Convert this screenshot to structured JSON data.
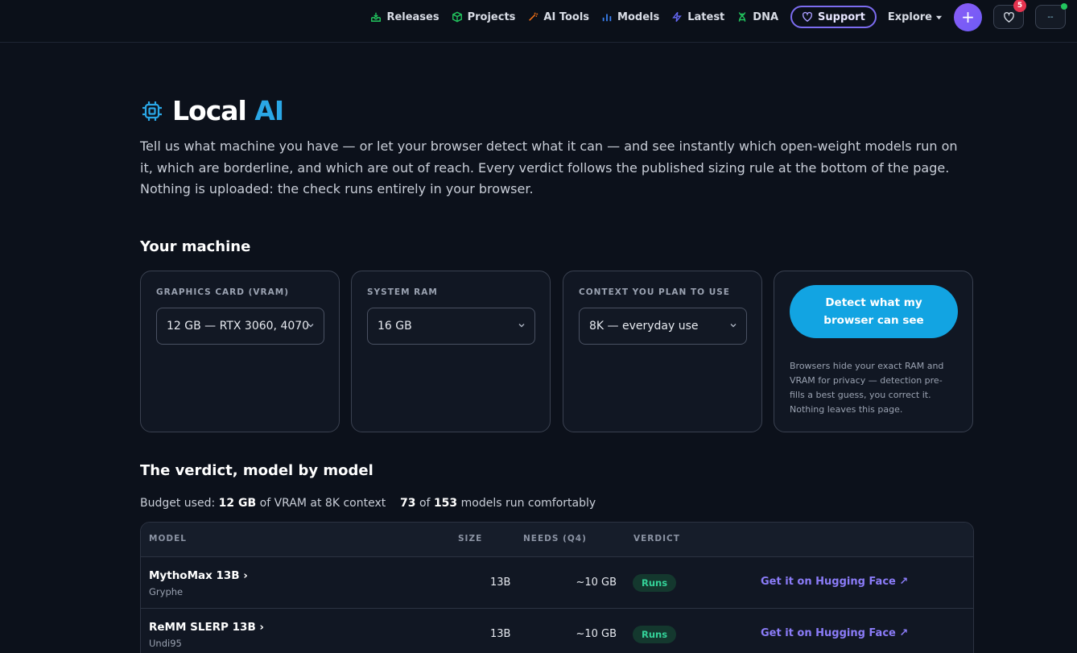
{
  "nav": {
    "links": [
      {
        "label": "Releases",
        "icon": "inbox-icon"
      },
      {
        "label": "Projects",
        "icon": "cube-icon"
      },
      {
        "label": "AI Tools",
        "icon": "wand-icon"
      },
      {
        "label": "Models",
        "icon": "bar-chart-icon"
      },
      {
        "label": "Latest",
        "icon": "lightning-icon"
      },
      {
        "label": "DNA",
        "icon": "dna-icon"
      }
    ],
    "support_label": "Support",
    "explore_label": "Explore",
    "plus_label": "+",
    "favorites_count": "5",
    "avatar_label": "--"
  },
  "page": {
    "title_main": "Local",
    "title_accent": "AI",
    "intro": "Tell us what machine you have — or let your browser detect what it can — and see instantly which open-weight models run on it, which are borderline, and which are out of reach. Every verdict follows the published sizing rule at the bottom of the page. Nothing is uploaded: the check runs entirely in your browser."
  },
  "machine": {
    "heading": "Your machine",
    "gpu": {
      "label": "GRAPHICS CARD (VRAM)",
      "value": "12 GB — RTX 3060, 4070"
    },
    "ram": {
      "label": "SYSTEM RAM",
      "value": "16 GB"
    },
    "context": {
      "label": "CONTEXT YOU PLAN TO USE",
      "value": "8K — everyday use"
    },
    "detect_label": "Detect what my browser can see",
    "detect_note": "Browsers hide your exact RAM and VRAM for privacy — detection pre-fills a best guess, you correct it. Nothing leaves this page."
  },
  "verdict": {
    "heading": "The verdict, model by model",
    "budget": {
      "prefix": "Budget used: ",
      "vram": "12 GB",
      "middle": " of VRAM at 8K context",
      "runs": "73",
      "of": " of ",
      "total": "153",
      "suffix": " models run comfortably"
    },
    "columns": {
      "model": "MODEL",
      "size": "SIZE",
      "needs": "NEEDS (Q4)",
      "verdict": "VERDICT"
    },
    "rows": [
      {
        "name": "MythoMax 13B ›",
        "author": "Gryphe",
        "size": "13B",
        "needs": "~10 GB",
        "verdict": "Runs",
        "link": "Get it on Hugging Face ↗"
      },
      {
        "name": "ReMM SLERP 13B ›",
        "author": "Undi95",
        "size": "13B",
        "needs": "~10 GB",
        "verdict": "Runs",
        "link": "Get it on Hugging Face ↗"
      }
    ]
  },
  "colors": {
    "accent": "#2aa7e6",
    "brand_purple": "#7c6cf0",
    "runs_green": "#34d399",
    "background": "#0c111b"
  }
}
